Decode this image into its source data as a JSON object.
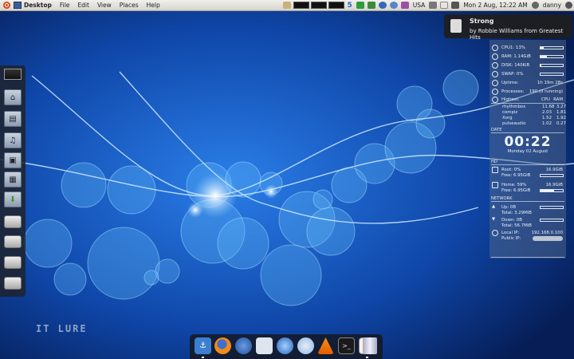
{
  "top_panel": {
    "menus": [
      "Desktop",
      "File",
      "Edit",
      "View",
      "Places",
      "Help"
    ],
    "tray_text_usa": "USA",
    "clock": "Mon 2 Aug, 12:22 AM",
    "user": "danny",
    "tray_badge": "5"
  },
  "notification": {
    "title": "Strong",
    "body": "by Robbie Williams from Greatest Hits"
  },
  "conky": {
    "cpu_label": "CPU1: 13%",
    "ram_label": "RAM: 1.14GiB",
    "disk_label": "DISK: 140KiB",
    "swap_label": "SWAP: 0%",
    "uptime_label": "Uptime:",
    "uptime_value": "1h 19m 28s",
    "processes_label": "Processes:",
    "processes_value": "190 (0 running)",
    "highest_label": "Highest:",
    "highest_col_cpu": "CPU",
    "highest_col_ram": "RAM",
    "processes": [
      {
        "name": "rhythmbox",
        "cpu": "11.68",
        "ram": "3.27"
      },
      {
        "name": "compiz",
        "cpu": "2.03",
        "ram": "1.81"
      },
      {
        "name": "Xorg",
        "cpu": "1.52",
        "ram": "1.92"
      },
      {
        "name": "pulseaudio",
        "cpu": "1.02",
        "ram": "0.27"
      }
    ],
    "date_section": "DATE",
    "clock": "00:22",
    "date": "Monday 02 August",
    "hd_section": "HD",
    "root_label": "Root: 0%",
    "root_size": "16.9GiB",
    "root_free": "Free: 6.95GiB",
    "home_label": "Home: 59%",
    "home_size": "16.9GiB",
    "home_free": "Free: 6.95GiB",
    "network_section": "NETWORK",
    "up_label": "Up: 0B",
    "up_total": "Total: 3.29MiB",
    "down_label": "Down: 0B",
    "down_total": "Total: 56.7MiB",
    "local_ip_label": "Local IP:",
    "local_ip": "192.168.0.100",
    "public_ip_label": "Public IP:",
    "bars": {
      "cpu": 0.13,
      "ram": 0.3,
      "disk": 0.05,
      "swap": 0.0,
      "root": 0.0,
      "home": 0.59
    }
  },
  "watermark": "IT LURE",
  "colors": {
    "accent": "#dd4814",
    "wallpaper": "#0a2f7a"
  }
}
